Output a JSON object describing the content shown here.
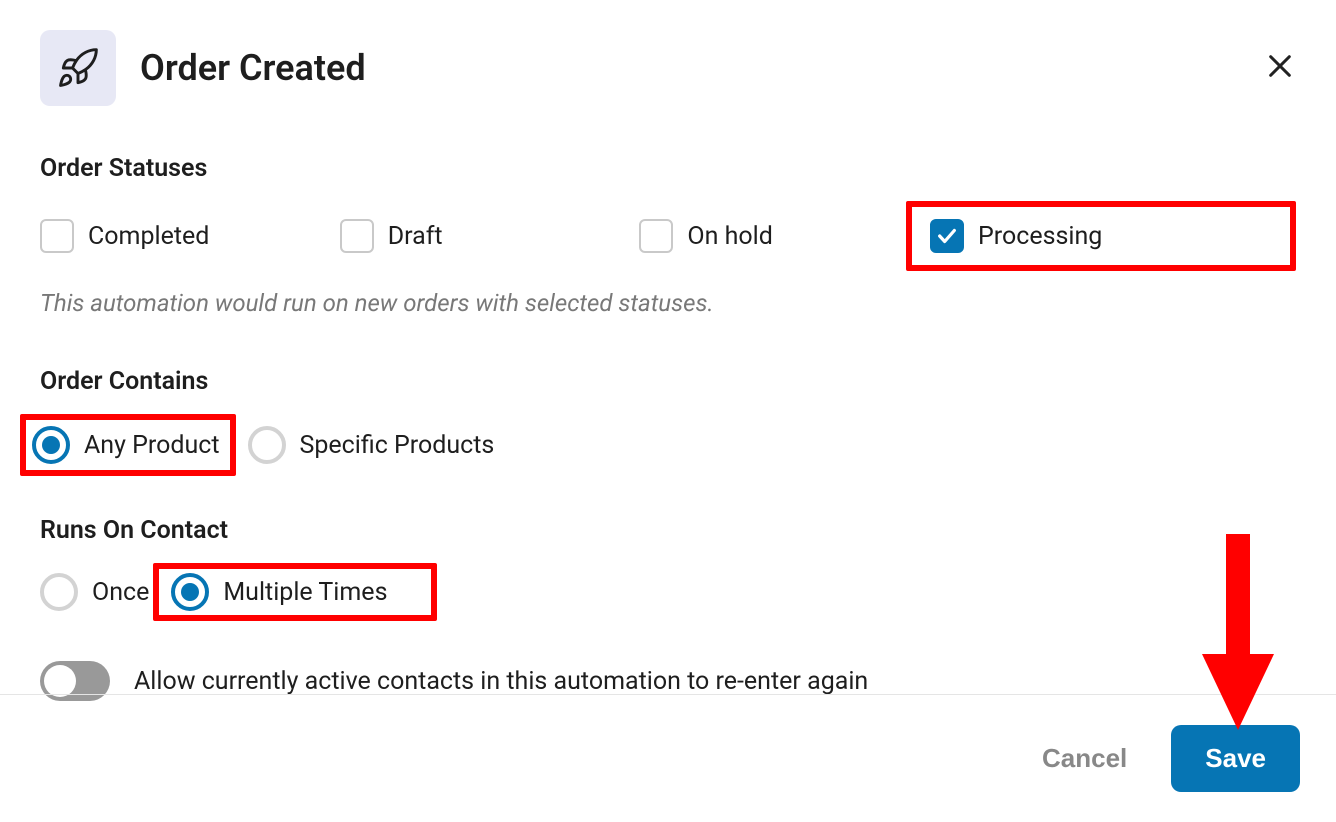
{
  "header": {
    "title": "Order Created"
  },
  "statuses": {
    "label": "Order Statuses",
    "items": {
      "completed": "Completed",
      "draft": "Draft",
      "on_hold": "On hold",
      "processing": "Processing"
    },
    "helper": "This automation would run on new orders with selected statuses."
  },
  "contains": {
    "label": "Order Contains",
    "any": "Any Product",
    "specific": "Specific Products"
  },
  "runs": {
    "label": "Runs On Contact",
    "once": "Once",
    "multiple": "Multiple Times"
  },
  "reenter": {
    "label": "Allow currently active contacts in this automation to re-enter again"
  },
  "footer": {
    "cancel": "Cancel",
    "save": "Save"
  }
}
